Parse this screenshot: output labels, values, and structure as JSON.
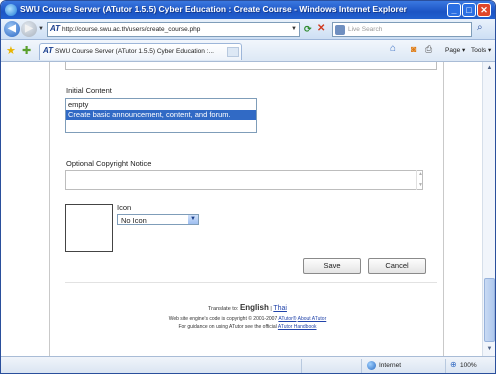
{
  "window": {
    "title": "SWU Course Server (ATutor 1.5.5) Cyber Education : Create Course - Windows Internet Explorer",
    "min_glyph": "_",
    "max_glyph": "□",
    "close_glyph": "✕"
  },
  "address_bar": {
    "url": "http://course.swu.ac.th/users/create_course.php",
    "search_placeholder": "Live Search"
  },
  "tabs": [
    {
      "label": "SWU Course Server (ATutor 1.5.5) Cyber Education :..."
    }
  ],
  "command_bar": {
    "page_label": "Page ▾",
    "tools_label": "Tools ▾"
  },
  "form": {
    "initial_content_label": "Initial Content",
    "initial_content_options": [
      "empty",
      "Create basic announcement, content, and forum."
    ],
    "initial_content_selected_index": 1,
    "copyright_label": "Optional Copyright Notice",
    "copyright_value": "",
    "icon_label": "Icon",
    "icon_selected": "No Icon",
    "save_label": "Save",
    "cancel_label": "Cancel"
  },
  "footer": {
    "translate_prefix": "Translate to:",
    "language_current": "English",
    "separator": "|",
    "language_other": "Thai",
    "copyright_line": "Web site engine's code is copyright © 2001-2007",
    "atutor_link": "ATutor®",
    "about_link": "About ATutor",
    "guidance_line": "For guidance on using ATutor see the official",
    "handbook_link": "ATutor Handbook"
  },
  "status_bar": {
    "zone": "Internet",
    "zoom": "100%"
  },
  "colors": {
    "titlebar": "#1c54c4",
    "selection": "#316ac5",
    "link": "#2244aa"
  }
}
